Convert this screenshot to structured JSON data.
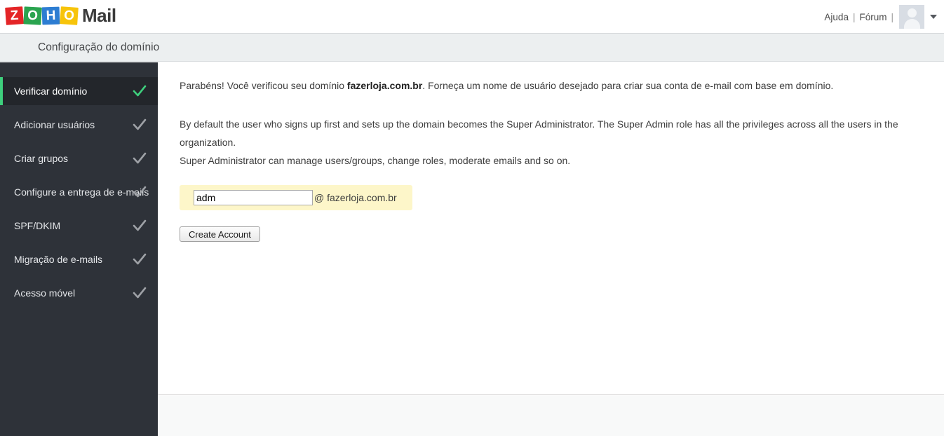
{
  "header": {
    "logo_tiles": [
      "Z",
      "O",
      "H",
      "O"
    ],
    "logo_word": "Mail",
    "help_label": "Ajuda",
    "forum_label": "Fórum",
    "separator": "|",
    "colors": {
      "tile_z": "#e42527",
      "tile_o1": "#2aa44f",
      "tile_h": "#2d7dd2",
      "tile_o2": "#f7c40a",
      "accent_green": "#3ecf7d",
      "sidebar_bg": "#2e3239",
      "sidebar_active_bg": "#23262b",
      "highlight_yellow": "#fdf6c9"
    }
  },
  "titlebar": {
    "title": "Configuração do domínio"
  },
  "sidebar": {
    "items": [
      {
        "label": "Verificar domínio",
        "checked": true,
        "active": true
      },
      {
        "label": "Adicionar usuários",
        "checked": true,
        "active": false
      },
      {
        "label": "Criar grupos",
        "checked": true,
        "active": false
      },
      {
        "label": "Configure a entrega de e-mails",
        "checked": true,
        "active": false
      },
      {
        "label": "SPF/DKIM",
        "checked": true,
        "active": false
      },
      {
        "label": "Migração de e-mails",
        "checked": true,
        "active": false
      },
      {
        "label": "Acesso móvel",
        "checked": true,
        "active": false
      }
    ]
  },
  "main": {
    "intro_prefix": "Parabéns! Você verificou seu domínio ",
    "intro_domain": "fazerloja.com.br",
    "intro_suffix": ". Forneça um nome de usuário desejado para criar sua conta de e-mail com base em domínio.",
    "paragraph_1": "By default the user who signs up first and sets up the domain becomes the Super Administrator. The Super Admin role has all the privileges across all the users in the organization.",
    "paragraph_2": "Super Administrator can manage users/groups, change roles, moderate emails and so on.",
    "username_value": "adm",
    "username_placeholder": "",
    "domain_suffix": "@ fazerloja.com.br",
    "create_button_label": "Create Account"
  }
}
